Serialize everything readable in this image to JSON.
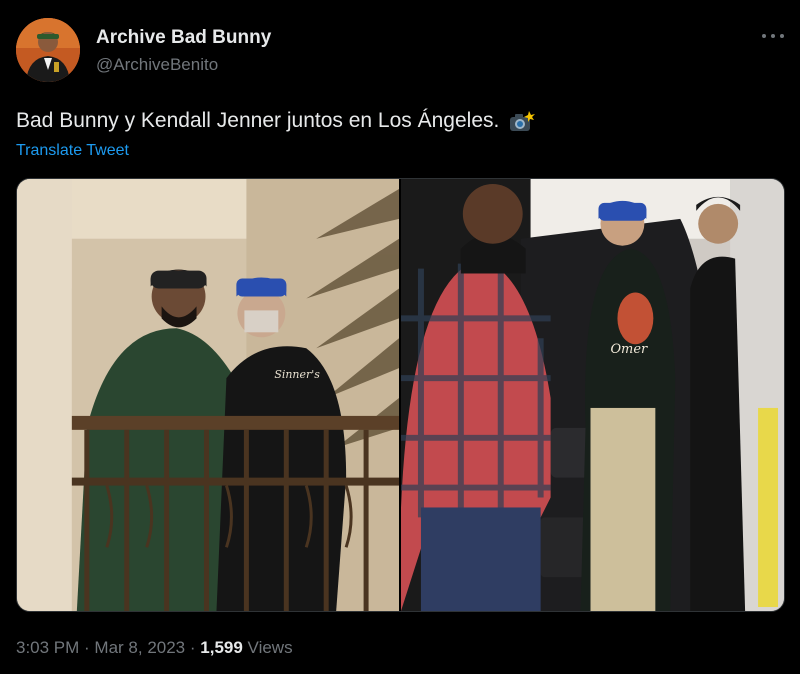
{
  "author": {
    "display_name": "Archive Bad Bunny",
    "handle": "@ArchiveBenito"
  },
  "tweet": {
    "text": "Bad Bunny y Kendall Jenner juntos en Los Ángeles.",
    "emoji_icon": "camera-flash-icon",
    "translate_label": "Translate Tweet"
  },
  "meta": {
    "time": "3:03 PM",
    "sep1": " · ",
    "date": "Mar 8, 2023",
    "sep2": " · ",
    "views_count": "1,599",
    "views_label": " Views"
  },
  "colors": {
    "background": "#000000",
    "text": "#e7e9ea",
    "secondary": "#71767b",
    "link": "#1d9bf0",
    "border": "#2f3336"
  }
}
